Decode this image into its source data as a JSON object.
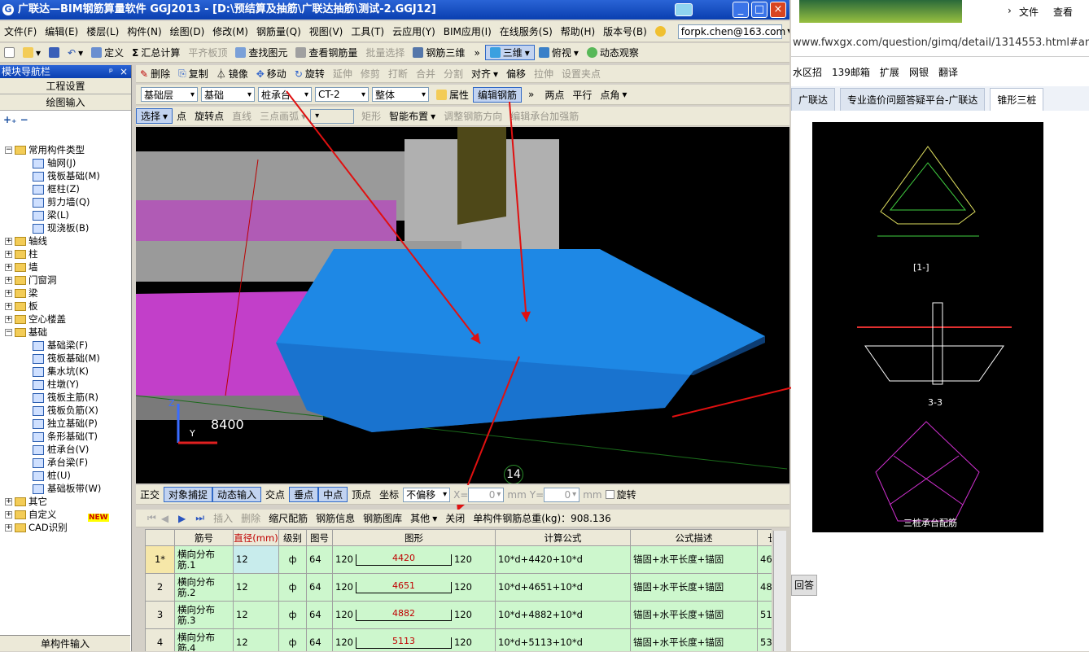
{
  "title": "广联达—BIM钢筋算量软件 GGJ2013 - [D:\\预结算及抽筋\\广联达抽筋\\测试-2.GGJ12]",
  "menu": [
    "文件(F)",
    "编辑(E)",
    "楼层(L)",
    "构件(N)",
    "绘图(D)",
    "修改(M)",
    "钢筋量(Q)",
    "视图(V)",
    "工具(T)",
    "云应用(Y)",
    "BIM应用(I)",
    "在线服务(S)",
    "帮助(H)",
    "版本号(B)"
  ],
  "account": "forpk.chen@163.com",
  "tb1": [
    "定义",
    "汇总计算",
    "平齐板顶",
    "查找图元",
    "查看钢筋量",
    "批量选择",
    "钢筋三维",
    "三维",
    "俯视",
    "动态观察"
  ],
  "tb2": [
    "删除",
    "复制",
    "镜像",
    "移动",
    "旋转",
    "延伸",
    "修剪",
    "打断",
    "合并",
    "分割",
    "对齐",
    "偏移",
    "拉伸",
    "设置夹点"
  ],
  "tb3": {
    "floor": "基础层",
    "type": "基础",
    "comp": "桩承台",
    "name": "CT-2",
    "part": "整体",
    "props": "属性",
    "edit": "编辑钢筋",
    "twopoint": "两点",
    "parallel": "平行",
    "pointangle": "点角"
  },
  "tb4": [
    "选择",
    "点",
    "旋转点",
    "直线",
    "三点画弧",
    "矩形",
    "智能布置",
    "调整钢筋方向",
    "编辑承台加强筋"
  ],
  "nav": {
    "header": "模块导航栏",
    "pin": "ᵖ",
    "close": "×",
    "proj": "工程设置",
    "draw": "绘图输入",
    "footer": "单构件输入"
  },
  "tree": [
    {
      "l": "常用构件类型",
      "lv": 0,
      "t": "folder-open"
    },
    {
      "l": "轴网(J)",
      "lv": 1
    },
    {
      "l": "筏板基础(M)",
      "lv": 1
    },
    {
      "l": "框柱(Z)",
      "lv": 1
    },
    {
      "l": "剪力墙(Q)",
      "lv": 1
    },
    {
      "l": "梁(L)",
      "lv": 1
    },
    {
      "l": "现浇板(B)",
      "lv": 1
    },
    {
      "l": "轴线",
      "lv": 0,
      "t": "folder"
    },
    {
      "l": "柱",
      "lv": 0,
      "t": "folder"
    },
    {
      "l": "墙",
      "lv": 0,
      "t": "folder"
    },
    {
      "l": "门窗洞",
      "lv": 0,
      "t": "folder"
    },
    {
      "l": "梁",
      "lv": 0,
      "t": "folder"
    },
    {
      "l": "板",
      "lv": 0,
      "t": "folder"
    },
    {
      "l": "空心楼盖",
      "lv": 0,
      "t": "folder"
    },
    {
      "l": "基础",
      "lv": 0,
      "t": "folder-open"
    },
    {
      "l": "基础梁(F)",
      "lv": 1
    },
    {
      "l": "筏板基础(M)",
      "lv": 1
    },
    {
      "l": "集水坑(K)",
      "lv": 1
    },
    {
      "l": "柱墩(Y)",
      "lv": 1
    },
    {
      "l": "筏板主筋(R)",
      "lv": 1
    },
    {
      "l": "筏板负筋(X)",
      "lv": 1
    },
    {
      "l": "独立基础(P)",
      "lv": 1
    },
    {
      "l": "条形基础(T)",
      "lv": 1
    },
    {
      "l": "桩承台(V)",
      "lv": 1
    },
    {
      "l": "承台梁(F)",
      "lv": 1
    },
    {
      "l": "桩(U)",
      "lv": 1
    },
    {
      "l": "基础板带(W)",
      "lv": 1
    },
    {
      "l": "其它",
      "lv": 0,
      "t": "folder"
    },
    {
      "l": "自定义",
      "lv": 0,
      "t": "folder"
    },
    {
      "l": "CAD识别",
      "lv": 0,
      "t": "folder"
    }
  ],
  "new_badge": "NEW",
  "view": {
    "dim": "8400",
    "axis_num": "14",
    "z": "Z",
    "y": "Y"
  },
  "snap": {
    "ortho": "正交",
    "snap": "对象捕捉",
    "dyn": "动态输入",
    "inter": "交点",
    "perp": "垂点",
    "mid": "中点",
    "vert": "顶点",
    "coord": "坐标",
    "offset": "不偏移",
    "x": "X=",
    "xv": "0",
    "y": "Y=",
    "yv": "0",
    "mm": "mm",
    "rotate": "旋转"
  },
  "rebar_tb": {
    "insert": "插入",
    "delete": "删除",
    "ruler": "缩尺配筋",
    "info": "钢筋信息",
    "lib": "钢筋图库",
    "other": "其他",
    "close": "关闭",
    "total": "单构件钢筋总重(kg)：908.136"
  },
  "table": {
    "headers": [
      "筋号",
      "直径(mm)",
      "级别",
      "图号",
      "图形",
      "计算公式",
      "公式描述",
      "长"
    ],
    "rows": [
      {
        "n": "1*",
        "name": "横向分布筋.1",
        "d": "12",
        "g": "ф",
        "f": "64",
        "a": "120",
        "v": "4420",
        "b": "120",
        "formula": "10*d+4420+10*d",
        "desc": "锚固+水平长度+锚固",
        "len": "46"
      },
      {
        "n": "2",
        "name": "横向分布筋.2",
        "d": "12",
        "g": "ф",
        "f": "64",
        "a": "120",
        "v": "4651",
        "b": "120",
        "formula": "10*d+4651+10*d",
        "desc": "锚固+水平长度+锚固",
        "len": "48"
      },
      {
        "n": "3",
        "name": "横向分布筋.3",
        "d": "12",
        "g": "ф",
        "f": "64",
        "a": "120",
        "v": "4882",
        "b": "120",
        "formula": "10*d+4882+10*d",
        "desc": "锚固+水平长度+锚固",
        "len": "51"
      },
      {
        "n": "4",
        "name": "横向分布筋.4",
        "d": "12",
        "g": "ф",
        "f": "64",
        "a": "120",
        "v": "5113",
        "b": "120",
        "formula": "10*d+5113+10*d",
        "desc": "锚固+水平长度+锚固",
        "len": "53"
      }
    ]
  },
  "browser": {
    "top": [
      "文件",
      "查看"
    ],
    "url": "www.fwxgx.com/question/gimq/detail/1314553.html#an",
    "favs": [
      "水区招",
      "139邮箱",
      "扩展",
      "网银",
      "翻译"
    ],
    "tabs": [
      "广联达",
      "专业造价问题答疑平台-广联达",
      "锥形三桩"
    ],
    "answer": "回答",
    "cad_labels": [
      "[1-]",
      "3-3",
      "三桩承台配筋"
    ]
  }
}
